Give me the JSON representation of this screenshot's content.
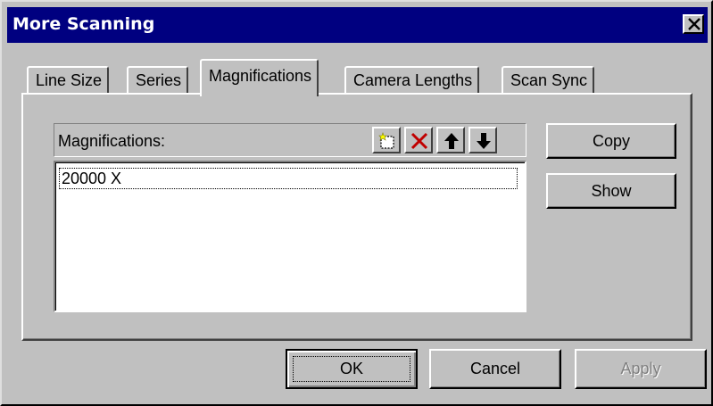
{
  "window": {
    "title": "More Scanning",
    "close_icon": "close-icon"
  },
  "tabs": [
    {
      "label": "Line Size",
      "active": false
    },
    {
      "label": "Series",
      "active": false
    },
    {
      "label": "Magnifications",
      "active": true
    },
    {
      "label": "Camera Lengths",
      "active": false
    },
    {
      "label": "Scan Sync",
      "active": false
    }
  ],
  "list": {
    "header_label": "Magnifications:",
    "tools": [
      {
        "name": "new-item-icon"
      },
      {
        "name": "delete-icon"
      },
      {
        "name": "move-up-icon"
      },
      {
        "name": "move-down-icon"
      }
    ],
    "items": [
      "20000 X"
    ]
  },
  "side_buttons": {
    "copy": "Copy",
    "show": "Show"
  },
  "footer_buttons": {
    "ok": "OK",
    "cancel": "Cancel",
    "apply": "Apply"
  },
  "colors": {
    "title_bar": "#000080",
    "face": "#c0c0c0",
    "delete_icon": "#c00000"
  }
}
